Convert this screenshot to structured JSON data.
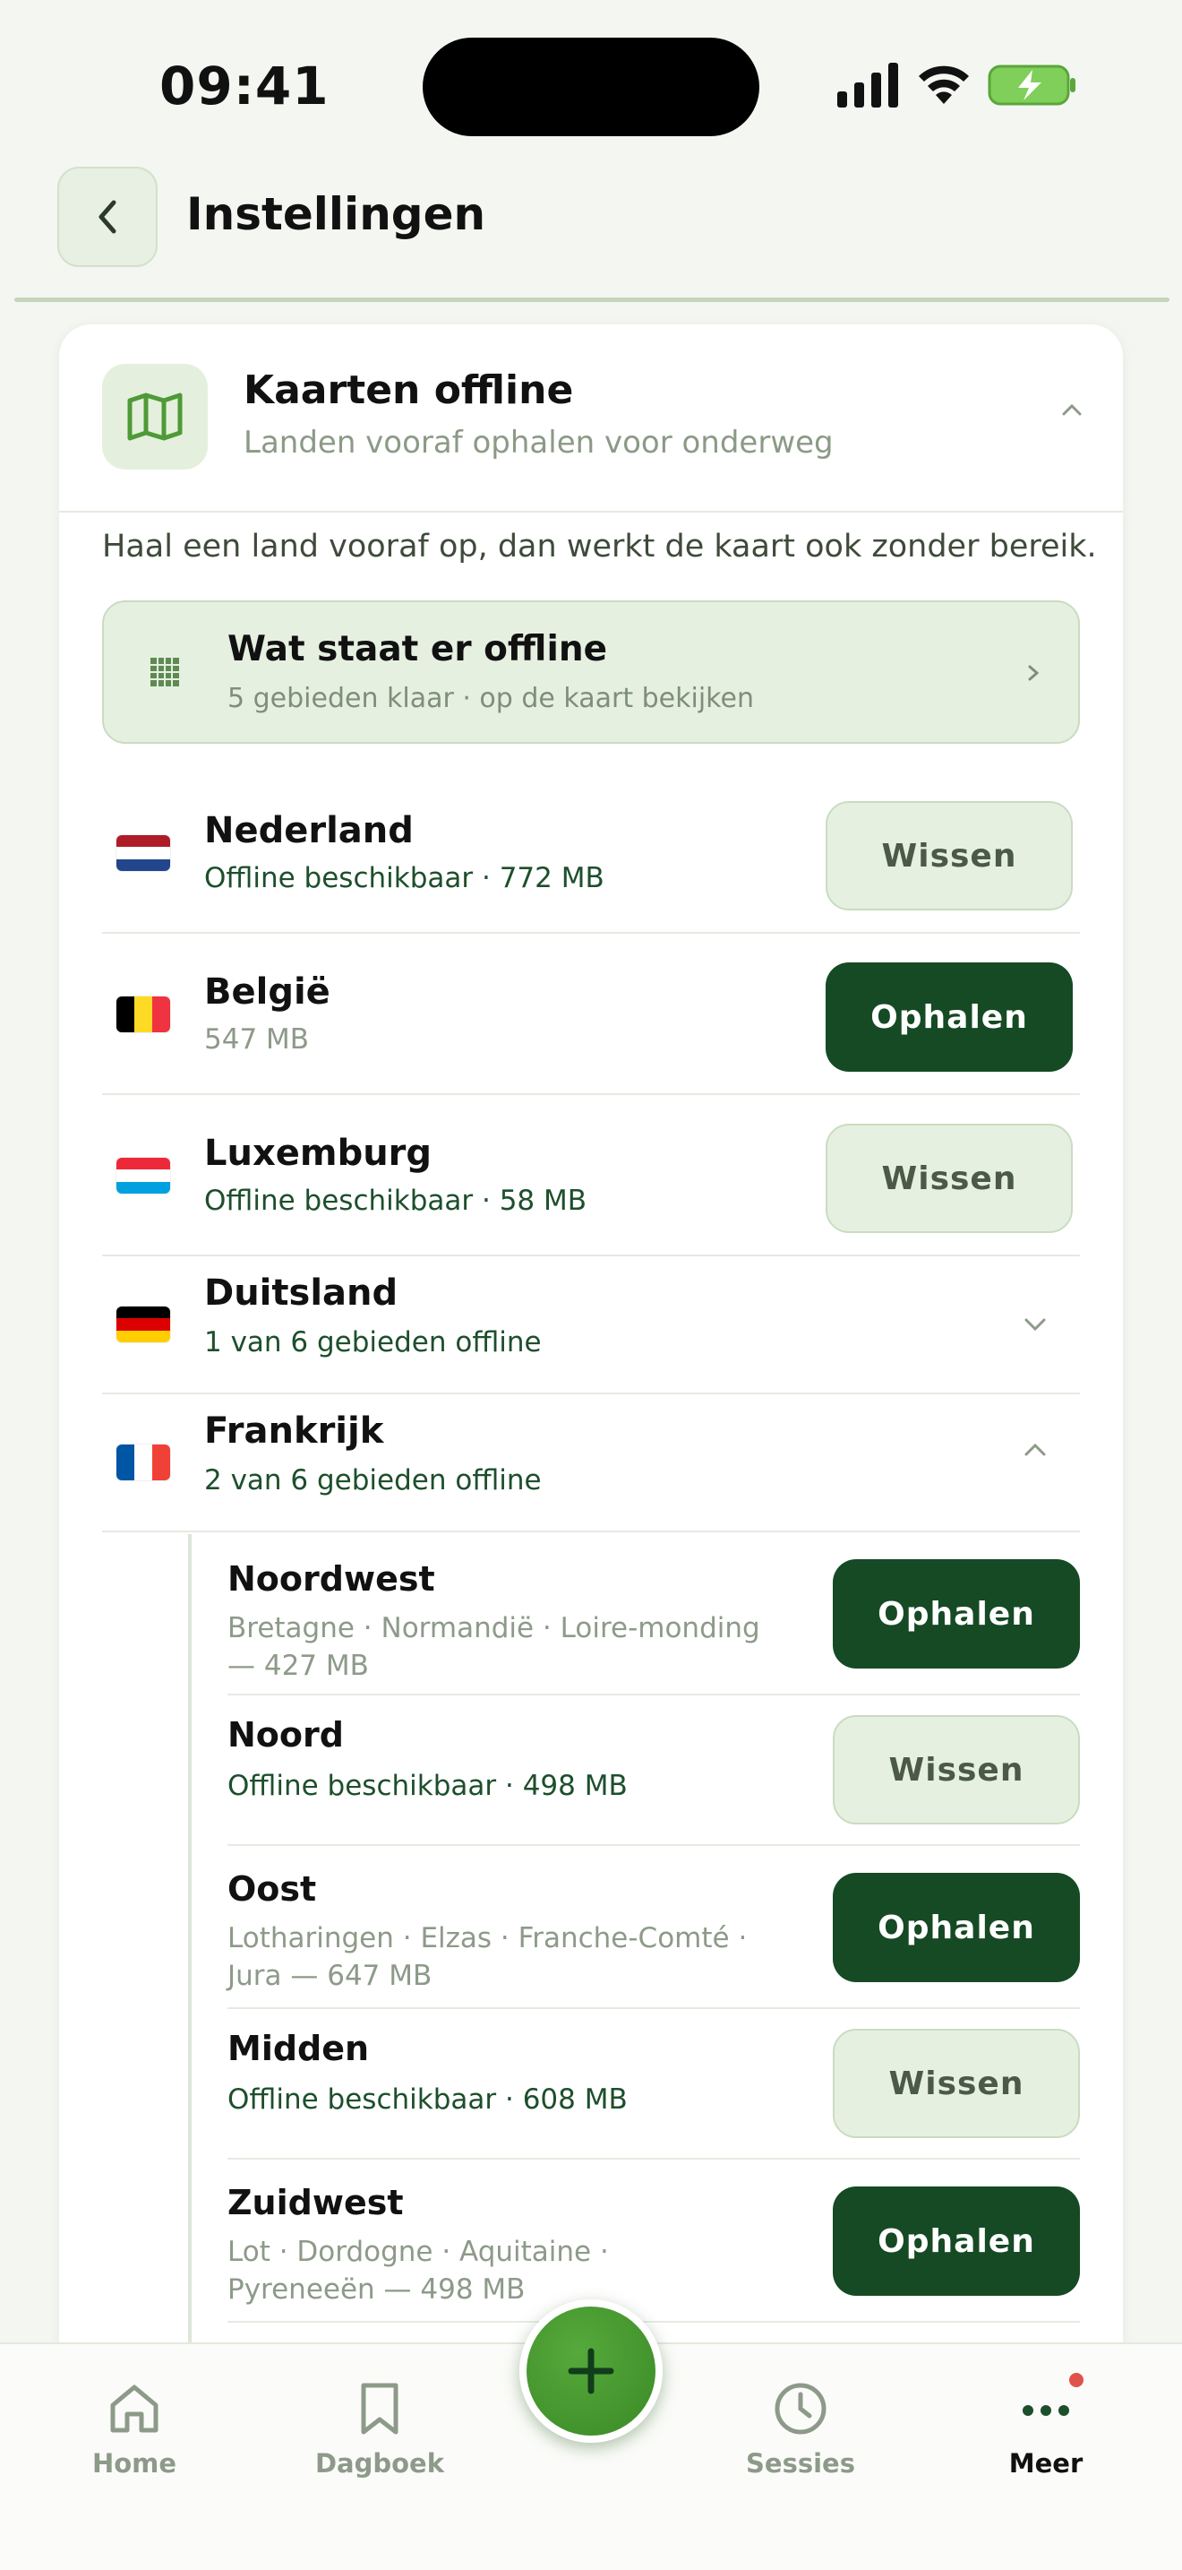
{
  "status_bar": {
    "time": "09:41"
  },
  "header": {
    "title": "Instellingen"
  },
  "card": {
    "title": "Kaarten offline",
    "subtitle": "Landen vooraf ophalen voor onderweg",
    "intro": "Haal een land vooraf op, dan werkt de kaart ook zonder bereik.",
    "summary": {
      "title": "Wat staat er offline",
      "subtitle": "5 gebieden klaar · op de kaart bekijken"
    }
  },
  "countries": [
    {
      "name": "Nederland",
      "status": "Offline beschikbaar · 772 MB",
      "action": "Wissen"
    },
    {
      "name": "België",
      "status": "547 MB",
      "action": "Ophalen"
    },
    {
      "name": "Luxemburg",
      "status": "Offline beschikbaar · 58 MB",
      "action": "Wissen"
    },
    {
      "name": "Duitsland",
      "status": "1 van 6 gebieden offline"
    },
    {
      "name": "Frankrijk",
      "status": "2 van 6 gebieden offline"
    }
  ],
  "regions": [
    {
      "name": "Noordwest",
      "desc": "Bretagne · Normandië · Loire-monding — 427 MB",
      "action": "Ophalen"
    },
    {
      "name": "Noord",
      "desc": "Offline beschikbaar · 498 MB",
      "action": "Wissen"
    },
    {
      "name": "Oost",
      "desc": "Lotharingen · Elzas · Franche-Comté · Jura — 647 MB",
      "action": "Ophalen"
    },
    {
      "name": "Midden",
      "desc": "Offline beschikbaar · 608 MB",
      "action": "Wissen"
    },
    {
      "name": "Zuidwest",
      "desc": "Lot · Dordogne · Aquitaine · Pyreneeën — 498 MB",
      "action": "Ophalen"
    }
  ],
  "nav": {
    "home": "Home",
    "journal": "Dagboek",
    "sessions": "Sessies",
    "more": "Meer"
  },
  "colors": {
    "accent_dark": "#154a24",
    "accent_light": "#e6f0e1",
    "fab_green": "#3a8a26",
    "status_green": "#1d4f2c",
    "notification": "#e0534b"
  }
}
